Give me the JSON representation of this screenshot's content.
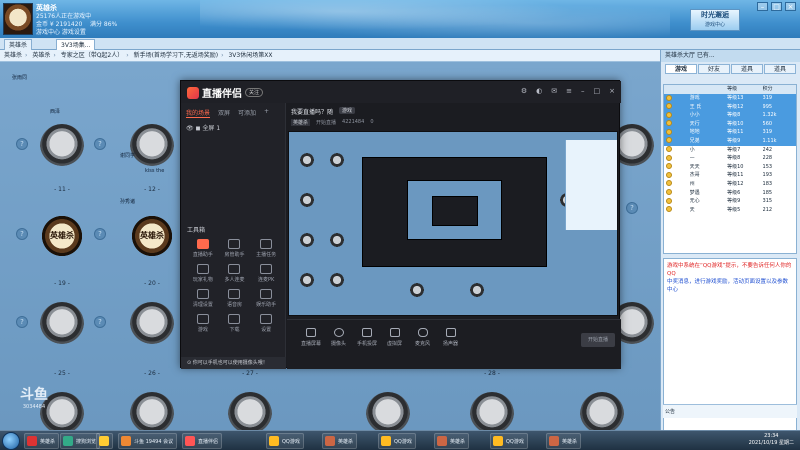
{
  "user": {
    "name": "英雄杀",
    "line1": "25176人正在游戏中",
    "line2": "金币 ¥ 2191420",
    "line3": "满分 86%",
    "line4": "游戏中心 游戏设置"
  },
  "header": {
    "logo_line1": "时光邂逅",
    "logo_line2": "游戏中心"
  },
  "tabs": [
    "英雄杀",
    "3V3场集..."
  ],
  "breadcrumb": [
    "英雄杀",
    "英雄杀",
    "专家之区（带Q起2人）",
    "新手场(首场学习下,无返场奖励)",
    "3V3休闲场第XX"
  ],
  "room": {
    "table_numbers": [
      "- 11 -",
      "- 12 -",
      "- 19 -",
      "- 20 -",
      "- 25 -",
      "- 26 -",
      "- 27 -",
      "- 28 -"
    ],
    "logo_text": "英雄杀",
    "player_names": [
      "张雨同",
      "西泽",
      "谢同学",
      "丁泽",
      "孙秀诸",
      "自由恋爱",
      "蜡烛",
      "kiss the"
    ]
  },
  "zb": {
    "app_name": "直播伴侣",
    "badge": "关注",
    "side_tabs": [
      "我的场景",
      "双屏",
      "节奏",
      "可添加"
    ],
    "scene_label": "全屏 1",
    "tools_title": "工具箱",
    "tools": [
      "直播助手",
      "房管助手",
      "主播任务",
      "玩家礼物",
      "多人连麦",
      "连麦PK",
      "清理设置",
      "语音房",
      "娱乐助手",
      "游戏",
      "下载",
      "设置"
    ],
    "title": "我要直播吗？随",
    "title_badge": "游戏",
    "meta": [
      "英雄杀",
      "开始直播",
      "4221484",
      "0"
    ],
    "bottom_buttons": [
      "直播屏幕",
      "摄像头",
      "手机投屏",
      "虚拟屏",
      "麦克风",
      "扬声器"
    ],
    "start_button": "开始直播",
    "tip": "你可以手机也可以使用摄像头哦！"
  },
  "right_panel": {
    "top": "英雄杀大厅  已有...",
    "tabs": [
      "游戏",
      "好友",
      "道具",
      "道具"
    ],
    "columns": [
      "",
      "",
      "等级",
      "积分"
    ],
    "rows": [
      [
        "★",
        "游戏",
        "等级13",
        "319"
      ],
      [
        "★",
        "王 氏",
        "等级12",
        "995"
      ],
      [
        "★",
        "小小",
        "等级8",
        "1.32k"
      ],
      [
        "★",
        "天行",
        "等级10",
        "560"
      ],
      [
        "★",
        "地地",
        "等级11",
        "319"
      ],
      [
        "★",
        "兄弟",
        "等级9",
        "1.11k"
      ],
      [
        "★",
        "小",
        "等级7",
        "242"
      ],
      [
        "★",
        "—",
        "等级8",
        "228"
      ],
      [
        "★",
        "天天",
        "等级10",
        "153"
      ],
      [
        "★",
        "杰哥",
        "等级11",
        "193"
      ],
      [
        "★",
        "州",
        "等级12",
        "183"
      ],
      [
        "★",
        "梦遇",
        "等级6",
        "185"
      ],
      [
        "★",
        "无心",
        "等级9",
        "315"
      ],
      [
        "★",
        "天",
        "等级5",
        "212"
      ]
    ],
    "chat_red": "游戏中系统在“QQ游戏”提示，不要告诉任何人你的QQ",
    "chat_blue": "中奖消息，进行游戏奖励，活动页面设置以及参数中心",
    "input_label": "公告"
  },
  "watermark": {
    "main": "斗鱼",
    "sub": "3034484"
  },
  "taskbar": {
    "items": [
      "英雄杀",
      "搜狗浏览",
      "",
      "斗鱼 19494 会议",
      "直播伴侣",
      "QQ游戏",
      "英雄杀",
      "QQ游戏",
      "英雄杀",
      "QQ游戏",
      "英雄杀"
    ],
    "time": "23:34",
    "date": "2021/10/19 星期二"
  }
}
